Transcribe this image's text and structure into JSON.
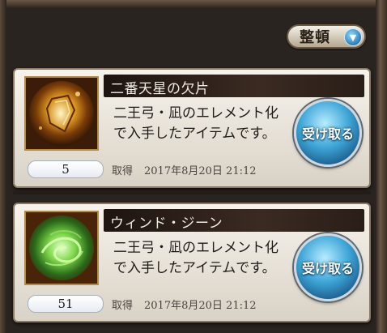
{
  "toolbar": {
    "sort_label": "整頓",
    "sort_icon": "chevron-down-icon"
  },
  "colors": {
    "card_bg": "#f7f3ec",
    "title_bar": "#2a1e18",
    "button_blue": "#3fa6d8"
  },
  "items": [
    {
      "title": "二番天星の欠片",
      "description_line1": "二王弓・凪のエレメント化",
      "description_line2": "で入手したアイテムです。",
      "receive_label": "受け取る",
      "count": "5",
      "obtained_label": "取得",
      "obtained_date": "2017年8月20日 21:12",
      "thumb_icon": "shard-gem-icon"
    },
    {
      "title": "ウィンド・ジーン",
      "description_line1": "二王弓・凪のエレメント化",
      "description_line2": "で入手したアイテムです。",
      "receive_label": "受け取る",
      "count": "51",
      "obtained_label": "取得",
      "obtained_date": "2017年8月20日 21:12",
      "thumb_icon": "wind-gene-icon"
    }
  ]
}
